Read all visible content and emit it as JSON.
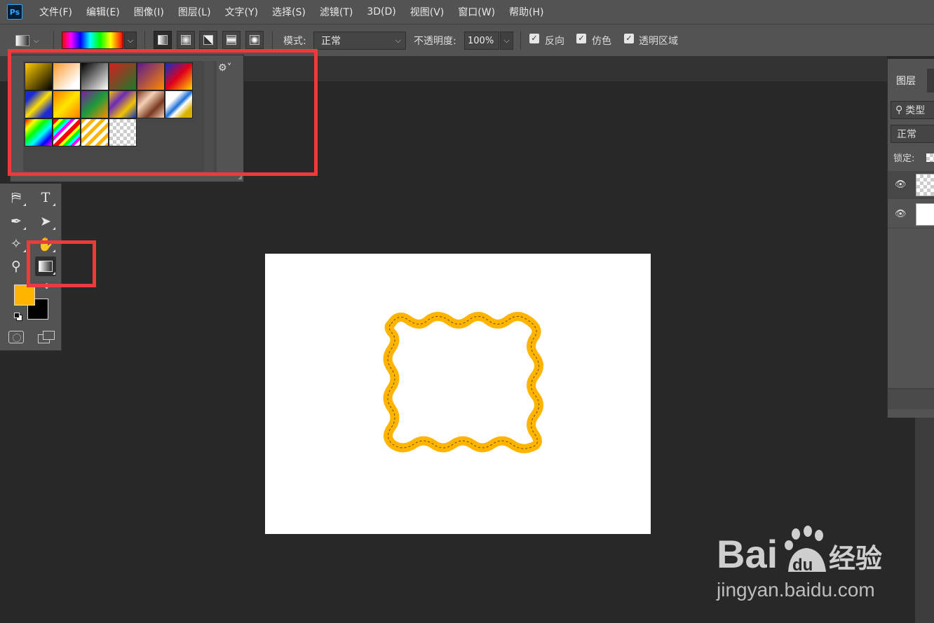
{
  "app": {
    "logo_text": "Ps"
  },
  "menu": [
    "文件(F)",
    "编辑(E)",
    "图像(I)",
    "图层(L)",
    "文字(Y)",
    "选择(S)",
    "滤镜(T)",
    "3D(D)",
    "视图(V)",
    "窗口(W)",
    "帮助(H)"
  ],
  "options": {
    "mode_label": "模式:",
    "mode_value": "正常",
    "opacity_label": "不透明度:",
    "opacity_value": "100%",
    "reverse_label": "反向",
    "dither_label": "仿色",
    "transparency_label": "透明区域",
    "reverse_checked": true,
    "dither_checked": true,
    "transparency_checked": true
  },
  "gradient_presets": [
    "linear-gradient(135deg,#ffcc00,#000)",
    "checker:#ff9a2e",
    "linear-gradient(135deg,#000,#fff)",
    "linear-gradient(135deg,#d21f1f,#1d7a2b)",
    "linear-gradient(135deg,#5b1a8c,#ff8a00)",
    "linear-gradient(135deg,#1030c8,#e0001a,#ffd400)",
    "linear-gradient(135deg,#1a2ad0 20%,#ffe000 50%,#1a2ad0 80%)",
    "linear-gradient(135deg,#ff7a00,#ffe600,#ff7a00)",
    "linear-gradient(135deg,#7a1fa0,#1d9a3a,#ff8a00)",
    "linear-gradient(135deg,#f2c300,#6b2bb8,#f2c300,#1030c8)",
    "linear-gradient(135deg,#7a3a20,#f4d0b8,#7a3a20,#f4d0b8)",
    "linear-gradient(135deg,#ffffff 30%,#1a70d8 50%,#ffffff 60%,#d8b200 80%)",
    "linear-gradient(135deg,#ff0000,#ffff00,#00ff00,#00ffff,#0000ff,#ff00ff)",
    "checker-rainbow",
    "checker-stripe",
    "checker"
  ],
  "picker": {
    "gear_icon": "gear-icon"
  },
  "tools": {
    "fg_color": "#ffb400",
    "bg_color": "#000000"
  },
  "layers": {
    "tab_label": "图层",
    "search_label": "类型",
    "blend_value": "正常",
    "lock_label": "锁定:"
  },
  "colors": {
    "accent_highlight": "#ee3a3a",
    "shape_stroke": "#ffb400"
  },
  "watermark": {
    "url_text": "jingyan.baidu.com"
  }
}
